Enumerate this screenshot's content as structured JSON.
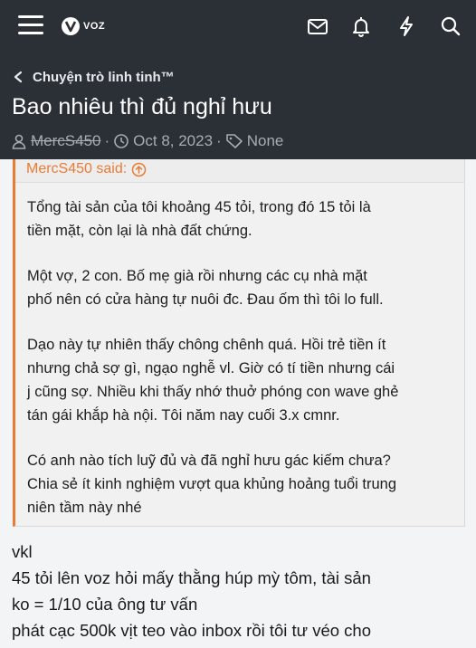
{
  "nav": {
    "logo_text": "VOZ",
    "icons": [
      "menu-icon",
      "mail-icon",
      "bell-icon",
      "lightning-icon",
      "search-icon"
    ]
  },
  "breadcrumb": {
    "label": "Chuyện trò linh tinh™"
  },
  "thread": {
    "title": "Bao nhiêu thì đủ nghỉ hưu",
    "author": "MercS450",
    "separator": "·",
    "date": "Oct 8, 2023",
    "tags": "None"
  },
  "quote": {
    "header": "MercS450 said:",
    "paragraphs": [
      [
        "Tổng tài sản của tôi khoảng 45 tỏi, trong đó 15 tỏi là",
        "tiền mặt, còn lại là nhà đất chứng."
      ],
      [
        "Một vợ, 2 con. Bố mẹ già rồi nhưng các cụ nhà mặt",
        "phố nên có cửa hàng tự nuôi đc. Đau ốm thì tôi lo full."
      ],
      [
        "Dạo này tự nhiên thấy chông chênh quá. Hồi trẻ tiền ít",
        "nhưng chả sợ gì, ngạo nghễ vl. Giờ có tí tiền nhưng cái",
        "j cũng sợ. Nhiều khi thấy nhớ thuở phóng con wave ghẻ",
        "tán gái khắp hà nội. Tôi năm nay cuối 3.x cmnr."
      ],
      [
        "Có anh nào tích luỹ đủ và đã nghỉ hưu gác kiếm chưa?",
        "Chia sẻ ít kinh nghiệm vượt qua khủng hoảng tuổi trung",
        "niên tầm này nhé"
      ]
    ]
  },
  "reply": {
    "lines": [
      "vkl",
      "45 tỏi lên voz hỏi mấy thằng húp mỳ tôm, tài sản",
      "ko = 1/10 của ông tư vấn",
      "phát cạc 500k vịt teo vào inbox rồi tôi tư véo cho"
    ]
  },
  "colors": {
    "header_bg": "#2b3036",
    "accent": "#e97c35",
    "quote_bg": "#f1f1f1",
    "meta_text": "#a7acb3"
  }
}
